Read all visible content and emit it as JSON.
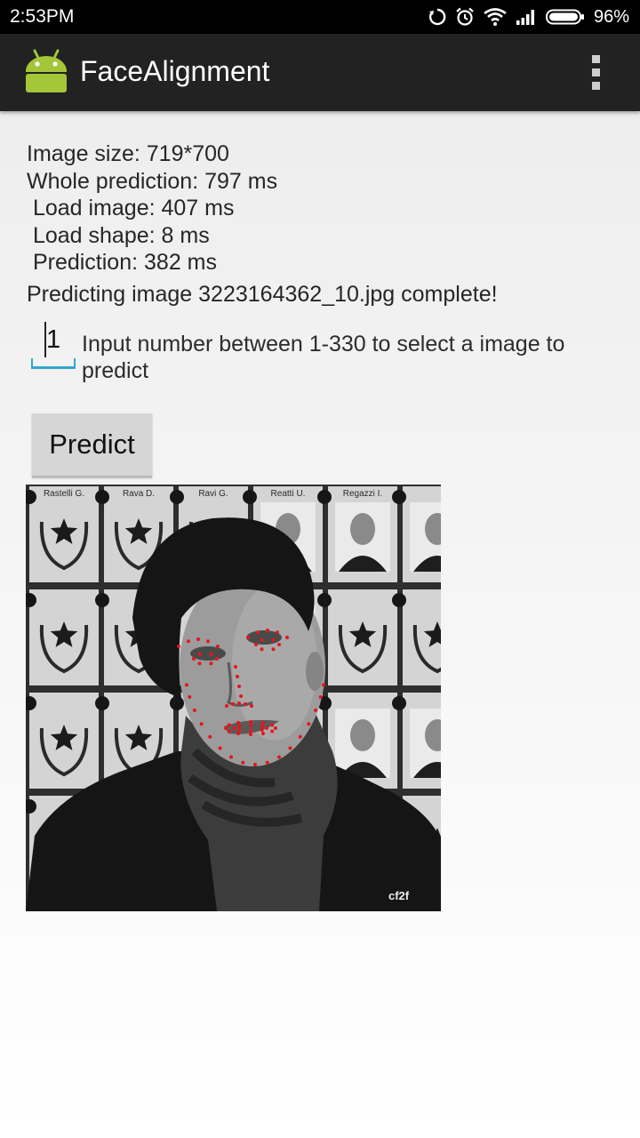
{
  "status_bar": {
    "time": "2:53PM",
    "battery_percent": "96%",
    "icons": [
      "sync-icon",
      "alarm-icon",
      "wifi-icon",
      "signal-icon",
      "battery-icon"
    ]
  },
  "action_bar": {
    "title": "FaceAlignment",
    "icons": [
      "android-app-icon",
      "overflow-menu-icon"
    ],
    "color": "#222222"
  },
  "results": {
    "image_size": "Image size: 719*700",
    "whole_prediction": "Whole prediction: 797 ms",
    "load_image": " Load image: 407 ms",
    "load_shape": " Load shape: 8 ms",
    "prediction": " Prediction: 382 ms",
    "complete_message": "Predicting image 3223164362_10.jpg complete!"
  },
  "image_selector": {
    "value": "1",
    "hint": "Input number between 1-330 to select a image to predict",
    "accent_color": "#33a6cc"
  },
  "predict_button": {
    "label": "Predict"
  },
  "result_image": {
    "plaque_names": [
      "Rastelli G.",
      "Rava D.",
      "Ravi G.",
      "Reatti U.",
      "Regazzi I."
    ],
    "watermark": "cf2f",
    "landmark_color": "#e8141c"
  }
}
